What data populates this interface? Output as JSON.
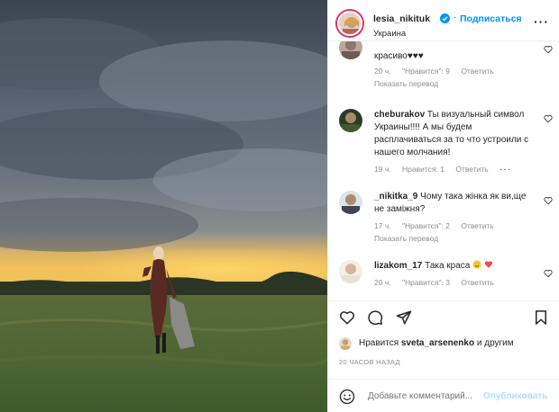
{
  "post": {
    "username": "lesia_nikituk",
    "follow_label": "Подписаться",
    "location": "Украина",
    "more_label": "···"
  },
  "comments": [
    {
      "username": "",
      "text": "красиво♥♥♥",
      "time": "20 ч.",
      "likes": "\"Нравится\": 9",
      "reply": "Ответить",
      "translate": "Показать перевод"
    },
    {
      "username": "cheburakov",
      "text": "Ты визуальный символ Украины!!!! А мы будем расплачиваться за то что устроили с нашего молчания!",
      "time": "19 ч.",
      "likes": "Нравится: 1",
      "reply": "Ответить",
      "more": "···"
    },
    {
      "username": "_nikitka_9",
      "text": "Чому така жінка як ви,ще не заміжня?",
      "time": "17 ч.",
      "likes": "\"Нравится\": 2",
      "reply": "Ответить",
      "translate": "Показать перевод"
    },
    {
      "username": "lizakom_17",
      "text": "Така краса",
      "time": "20 ч.",
      "likes": "\"Нравится\": 3",
      "reply": "Ответить"
    }
  ],
  "likes": {
    "prefix": "Нравится",
    "user": "sveta_arsenenko",
    "suffix": "и другим"
  },
  "time_ago": "20 ЧАСОВ НАЗАД",
  "add_comment": {
    "placeholder": "Добавьте комментарий...",
    "publish_label": "Опубликовать"
  },
  "colors": {
    "link_blue": "#0095f6",
    "publish_disabled": "#b3dbff",
    "muted": "#8e8e8e",
    "heart_red": "#ed4956"
  },
  "icons": [
    "heart-icon",
    "comment-icon",
    "share-icon",
    "bookmark-icon",
    "smile-icon",
    "verified-icon"
  ]
}
